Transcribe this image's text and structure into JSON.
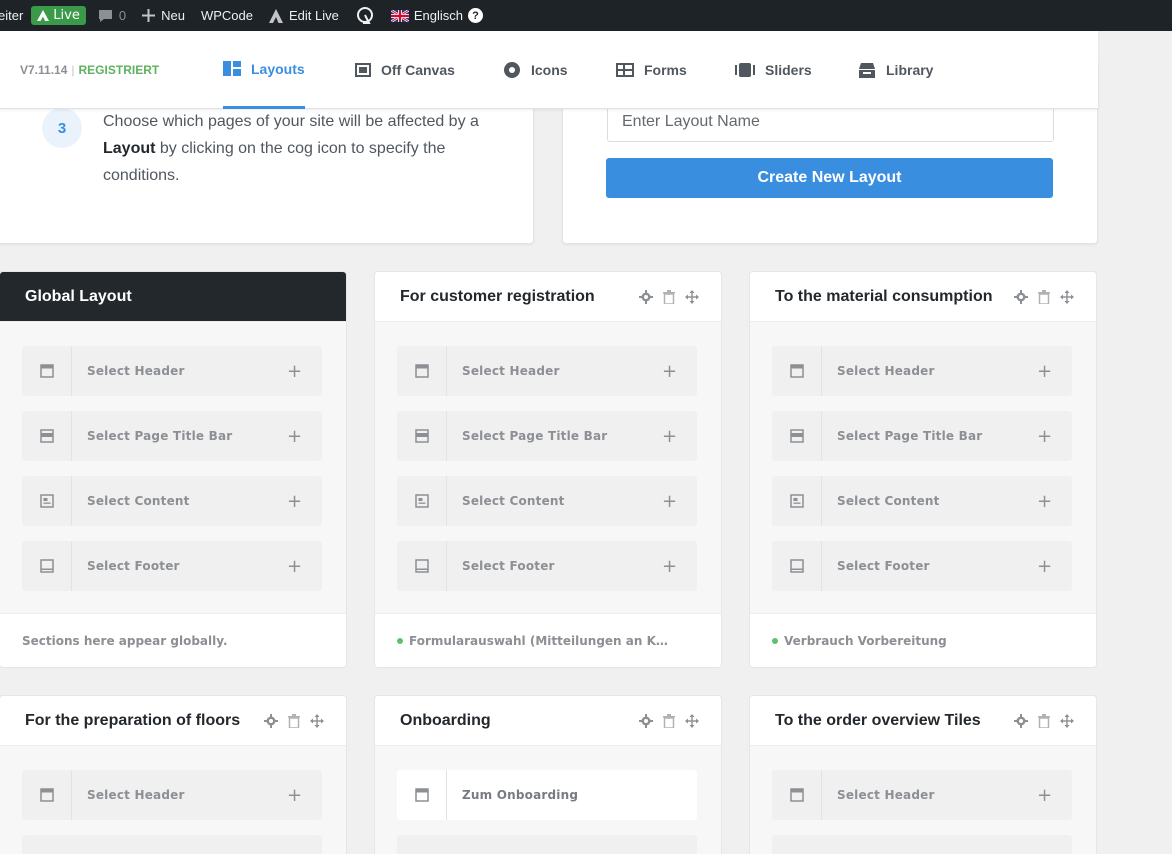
{
  "adminbar": {
    "partial_item": "eiter",
    "live": "Live",
    "comments_count": "0",
    "new_label": "Neu",
    "wpcode": "WPCode",
    "edit_live": "Edit Live",
    "language": "Englisch"
  },
  "header": {
    "version": "V7.11.14",
    "status": "REGISTRIERT",
    "tabs": [
      {
        "label": "Layouts",
        "icon": "layouts-icon",
        "active": true
      },
      {
        "label": "Off Canvas",
        "icon": "off-canvas-icon"
      },
      {
        "label": "Icons",
        "icon": "icons-icon"
      },
      {
        "label": "Forms",
        "icon": "forms-icon"
      },
      {
        "label": "Sliders",
        "icon": "sliders-icon"
      },
      {
        "label": "Library",
        "icon": "library-icon"
      }
    ]
  },
  "intro": {
    "step_number": "3",
    "step_text_before": "Choose which pages of your site will be affected by a",
    "step_text_bold": "Layout",
    "step_text_after": "by clicking on the cog icon to specify the conditions.",
    "layout_name_placeholder": "Enter Layout Name",
    "create_button": "Create New Layout"
  },
  "sections": {
    "header": "Select Header",
    "page_title_bar": "Select Page Title Bar",
    "content": "Select Content",
    "footer": "Select Footer"
  },
  "layouts": [
    {
      "title": "Global Layout",
      "footer": "Sections here appear globally."
    },
    {
      "title": "For customer registration",
      "footer": "Formularauswahl (Mitteilungen an K…"
    },
    {
      "title": "To the material consumption",
      "footer": "Verbrauch Vorbereitung"
    },
    {
      "title": "For the preparation of floors",
      "header_value": "Select Header"
    },
    {
      "title": "Onboarding",
      "header_value": "Zum Onboarding"
    },
    {
      "title": "To the order overview Tiles",
      "header_value": "Select Header"
    }
  ],
  "colors": {
    "accent": "#3a8ee0",
    "registered": "#5fb25f",
    "admin_bar": "#1d2327",
    "live_badge": "#3a9a4a",
    "condition_dot": "#5fbf6a"
  }
}
